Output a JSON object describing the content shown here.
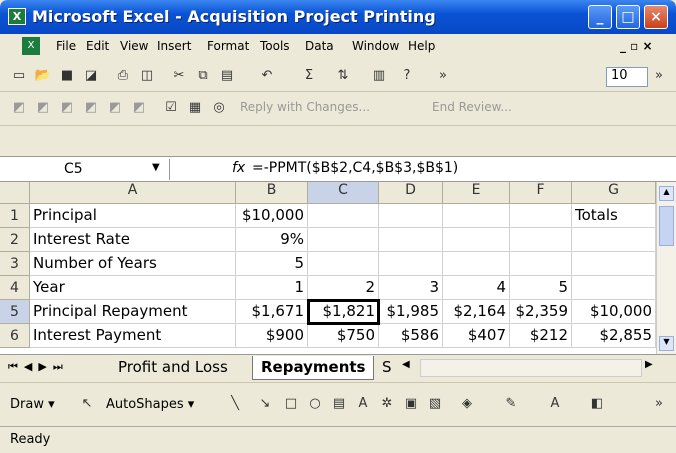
{
  "window": {
    "title": "Microsoft Excel - Acquisition Project Printing",
    "app_icon": "X"
  },
  "menu": [
    "File",
    "Edit",
    "View",
    "Insert",
    "Format",
    "Tools",
    "Data",
    "Window",
    "Help"
  ],
  "toolbar": {
    "font_size": "10",
    "reply_changes": "Reply with Changes...",
    "end_review": "End Review..."
  },
  "formula_bar": {
    "name_box": "C5",
    "fx": "fx",
    "formula": "=-PPMT($B$2,C4,$B$3,$B$1)"
  },
  "columns": [
    "A",
    "B",
    "C",
    "D",
    "E",
    "F",
    "G"
  ],
  "rows": [
    {
      "num": "1",
      "cells": [
        "Principal",
        "$10,000",
        "",
        "",
        "",
        "",
        "Totals"
      ]
    },
    {
      "num": "2",
      "cells": [
        "Interest Rate",
        "9%",
        "",
        "",
        "",
        "",
        ""
      ]
    },
    {
      "num": "3",
      "cells": [
        "Number of Years",
        "5",
        "",
        "",
        "",
        "",
        ""
      ]
    },
    {
      "num": "4",
      "cells": [
        "Year",
        "1",
        "2",
        "3",
        "4",
        "5",
        ""
      ]
    },
    {
      "num": "5",
      "cells": [
        "Principal Repayment",
        "$1,671",
        "$1,821",
        "$1,985",
        "$2,164",
        "$2,359",
        "$10,000"
      ]
    },
    {
      "num": "6",
      "cells": [
        "Interest Payment",
        "$900",
        "$750",
        "$586",
        "$407",
        "$212",
        "$2,855"
      ]
    }
  ],
  "sheets": {
    "tab1": "Profit and Loss",
    "tab2": "Repayments",
    "tab3": "S"
  },
  "drawing": {
    "draw": "Draw",
    "autoshapes": "AutoShapes"
  },
  "status": "Ready"
}
